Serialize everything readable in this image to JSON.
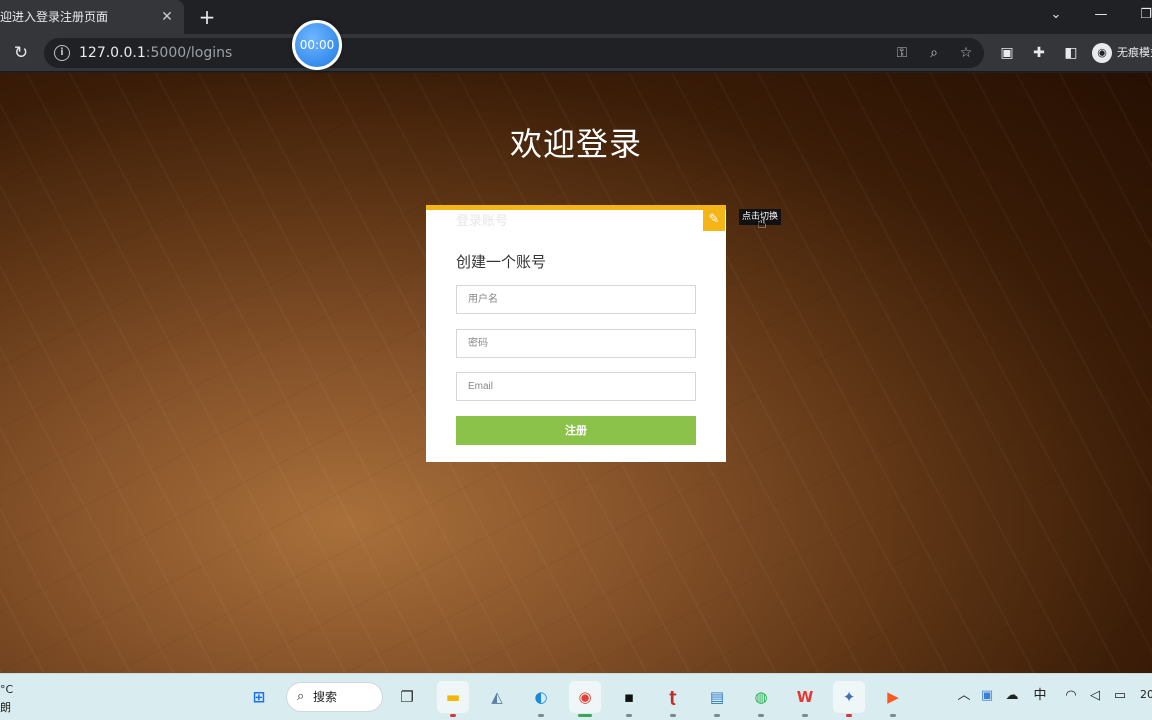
{
  "browser": {
    "tab_title": "迎进入登录注册页面",
    "tab_close": "✕",
    "new_tab": "+",
    "url_host": "127.0.0.1",
    "url_rest": ":5000/logins",
    "profile_label": "无痕模式",
    "window_controls": {
      "tab_search": "⌄",
      "minimize": "—",
      "restore": "❐"
    }
  },
  "recorder": {
    "timer": "00:00"
  },
  "page": {
    "title": "欢迎登录",
    "card": {
      "ghost_label": "登录账号",
      "heading": "创建一个账号",
      "fields": {
        "username_placeholder": "用户名",
        "password_placeholder": "密码",
        "email_placeholder": "Email"
      },
      "submit_label": "注册",
      "switch_tooltip": "点击切换"
    }
  },
  "taskbar": {
    "weather_temp": "°C",
    "weather_cond": "朗",
    "search_label": "搜索",
    "apps": [
      "start",
      "search",
      "task-view",
      "file-explorer",
      "resource-monitor",
      "edge",
      "chrome",
      "pycharm",
      "typora",
      "notepad",
      "wechat",
      "wps",
      "game",
      "recorder"
    ],
    "tray_ime": "中",
    "clock_fragment": "20"
  },
  "colors": {
    "accent_yellow": "#f4b617",
    "submit_green": "#8bc34a",
    "chrome_dark": "#202124",
    "toolbar": "#35363a",
    "taskbar": "#d9ecef"
  }
}
